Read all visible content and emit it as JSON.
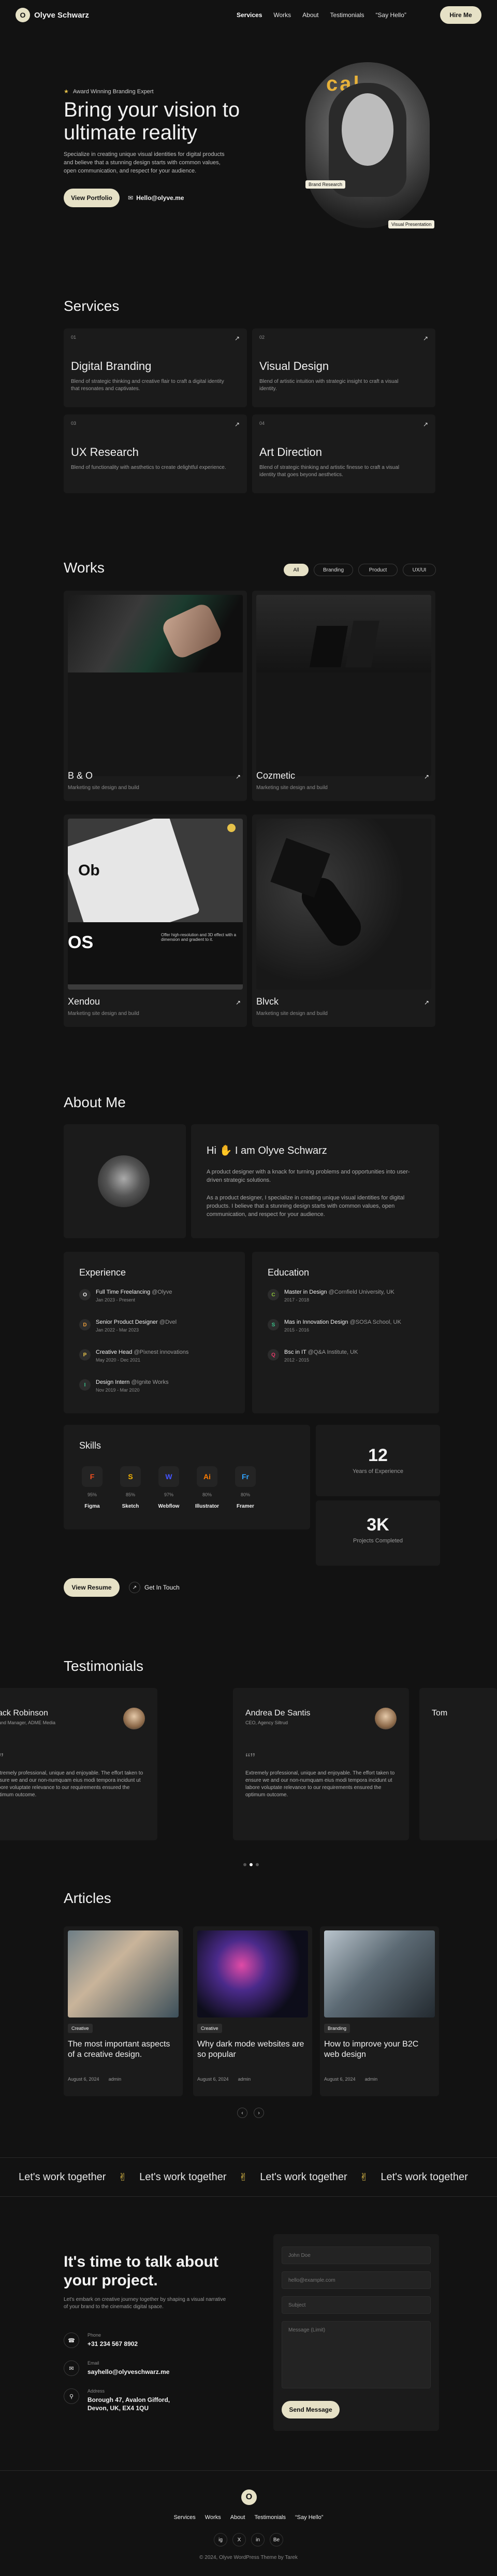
{
  "header": {
    "brand": "Olyve Schwarz",
    "logo_char": "O",
    "nav": [
      "Services",
      "Works",
      "About",
      "Testimonials",
      "“Say Hello”"
    ],
    "hire": "Hire Me"
  },
  "hero": {
    "badge": "Award Winning Branding Expert",
    "title": "Bring your vision to ultimate reality",
    "desc": "Specialize in creating unique visual identities for digital products and believe that a stunning design starts with common values, open communication, and respect for your audience.",
    "cta": "View Portfolio",
    "email": "Hello@olyve.me",
    "tag_brand": "Brand Research",
    "tag_visual": "Visual Presentation",
    "sign_text": "cal"
  },
  "services": {
    "title": "Services",
    "items": [
      {
        "num": "01",
        "title": "Digital Branding",
        "desc": "Blend of strategic thinking and creative flair to craft a digital identity that resonates and captivates."
      },
      {
        "num": "02",
        "title": "Visual Design",
        "desc": "Blend of artistic intuition with strategic insight to craft a visual identity."
      },
      {
        "num": "03",
        "title": "UX Research",
        "desc": "Blend of functionality with aesthetics to create delightful experience."
      },
      {
        "num": "04",
        "title": "Art Direction",
        "desc": "Blend of strategic thinking and artistic finesse to craft a visual identity that goes beyond aesthetics."
      }
    ]
  },
  "works": {
    "title": "Works",
    "filters": [
      "All",
      "Branding",
      "Product",
      "UX/UI"
    ],
    "items": [
      {
        "title": "B & O",
        "sub": "Marketing site design and build"
      },
      {
        "title": "Cozmetic",
        "sub": "Marketing site design and build"
      },
      {
        "title": "Xendou",
        "sub": "Marketing site design and build"
      },
      {
        "title": "Blvck",
        "sub": "Marketing site design and build"
      }
    ],
    "mock_text_1": "Ob",
    "mock_text_2": "OS",
    "mock_caption": "Offer high-resolution and 3D effect with a dimension and gradient to it."
  },
  "about": {
    "title": "About Me",
    "greeting": "Hi",
    "name_line": "I am Olyve Schwarz",
    "wave": "✋",
    "p1": "A product designer with a knack for turning problems and opportunities into user-driven strategic solutions.",
    "p2": "As a product designer, I specialize in creating unique visual identities for digital products. I believe that a stunning design starts with common values, open communication, and respect for your audience.",
    "exp_title": "Experience",
    "experience": [
      {
        "role": "Full Time Freelancing",
        "org": "@Olyve",
        "dates": "Jan 2023 - Present"
      },
      {
        "role": "Senior Product Designer",
        "org": "@Dvel",
        "dates": "Jan 2022 - Mar 2023"
      },
      {
        "role": "Creative Head",
        "org": "@Pixnest innovations",
        "dates": "May 2020 - Dec 2021"
      },
      {
        "role": "Design Intern",
        "org": "@Ignite Works",
        "dates": "Nov 2019 - Mar 2020"
      }
    ],
    "edu_title": "Education",
    "education": [
      {
        "role": "Master in Design",
        "org": "@Cornfield University, UK",
        "dates": "2017 - 2018"
      },
      {
        "role": "Mas in Innovation Design",
        "org": "@SOSA School, UK",
        "dates": "2015 - 2016"
      },
      {
        "role": "Bsc in IT",
        "org": "@Q&A Institute, UK",
        "dates": "2012 - 2015"
      }
    ],
    "skills_title": "Skills",
    "skills": [
      {
        "name": "Figma",
        "pct": "95%",
        "icon": "F"
      },
      {
        "name": "Sketch",
        "pct": "85%",
        "icon": "S"
      },
      {
        "name": "Webflow",
        "pct": "97%",
        "icon": "W"
      },
      {
        "name": "Illustrator",
        "pct": "80%",
        "icon": "Ai"
      },
      {
        "name": "Framer",
        "pct": "80%",
        "icon": "Fr"
      }
    ],
    "stats": [
      {
        "num": "12",
        "label": "Years of Experience"
      },
      {
        "num": "3K",
        "label": "Projects Completed"
      }
    ],
    "resume": "View Resume",
    "touch": "Get In Touch"
  },
  "testimonials": {
    "title": "Testimonials",
    "items": [
      {
        "name": "Jack Robinson",
        "pos": "Brand Manager, ADME Media",
        "quote": "Extremely professional, unique and enjoyable. The effort taken to ensure we and our non-numquam eius modi tempora incidunt ut labore voluptate relevance to our requirements ensured the optimum outcome."
      },
      {
        "name": "Andrea De Santis",
        "pos": "CEO, Agency Siltrud",
        "quote": "Extremely professional, unique and enjoyable. The effort taken to ensure we and our non-numquam eius modi tempora incidunt ut labore voluptate relevance to our requirements ensured the optimum outcome."
      },
      {
        "name": "Tom",
        "pos": ""
      }
    ]
  },
  "articles": {
    "title": "Articles",
    "items": [
      {
        "tag": "Creative",
        "title": "The most important aspects of a creative design.",
        "date": "August 6, 2024",
        "author": "admin"
      },
      {
        "tag": "Creative",
        "title": "Why dark mode websites are so popular",
        "date": "August 6, 2024",
        "author": "admin"
      },
      {
        "tag": "Branding",
        "title": "How to improve your B2C web design",
        "date": "August 6, 2024",
        "author": "admin"
      }
    ]
  },
  "marquee": {
    "text": "Let's work together",
    "hand": "✌"
  },
  "contact": {
    "title": "It's time to talk about your project.",
    "desc": "Let's embark on creative journey together by shaping a visual narrative of your brand to the cinematic digital space.",
    "phone_label": "Phone",
    "phone": "+31 234 567 8902",
    "email_label": "Email",
    "email": "sayhello@olyveschwarz.me",
    "addr_label": "Address",
    "address": "Borough 47, Avalon Gifford, Devon, UK, EX4 1QU",
    "ph_name": "John Doe",
    "ph_email": "hello@example.com",
    "ph_subject": "Subject",
    "ph_message": "Message (Limit)",
    "send": "Send Message"
  },
  "footer": {
    "nav": [
      "Services",
      "Works",
      "About",
      "Testimonials",
      "“Say Hello”"
    ],
    "social": [
      "ig",
      "X",
      "in",
      "Be"
    ],
    "copy": "© 2024, Olyve WordPress Theme by Tarek"
  }
}
